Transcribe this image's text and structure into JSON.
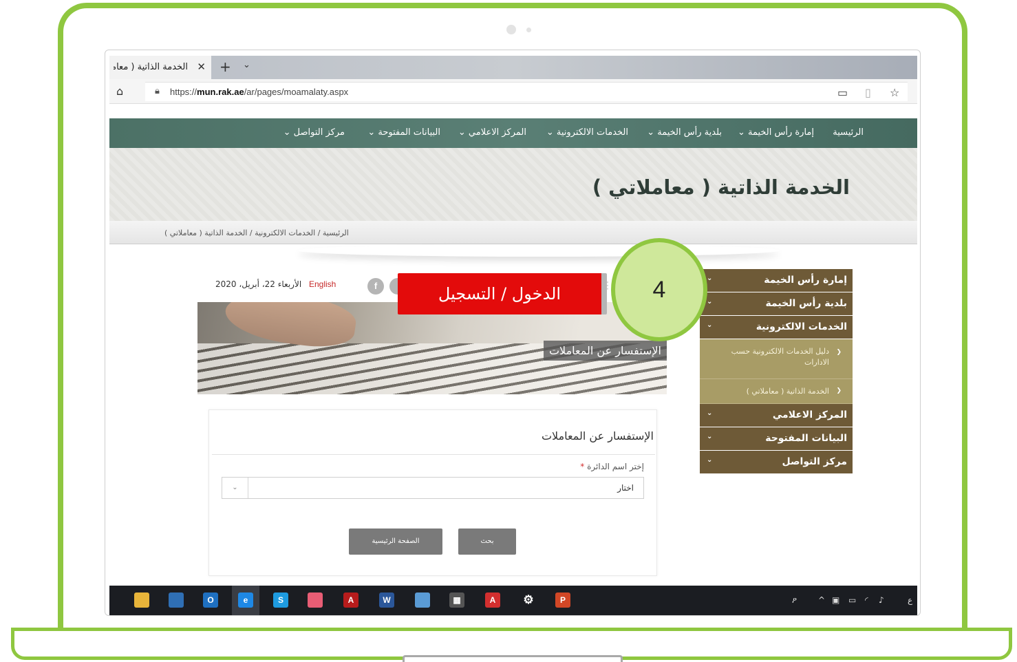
{
  "browser": {
    "tab_title": "الخدمة الذاتية ( معاملاتي )",
    "url_prefix": "https://",
    "url_domain": "mun.rak.ae",
    "url_path": "/ar/pages/moamalaty.aspx"
  },
  "nav": {
    "items": [
      {
        "label": "الرئيسية"
      },
      {
        "label": "إمارة رأس الخيمة ⌄"
      },
      {
        "label": "بلدية رأس الخيمة ⌄"
      },
      {
        "label": "الخدمات الالكترونية ⌄"
      },
      {
        "label": "المركز الاعلامي ⌄"
      },
      {
        "label": "البيانات المفتوحة ⌄"
      },
      {
        "label": "مركز التواصل ⌄"
      }
    ]
  },
  "page": {
    "title": "الخدمة الذاتية ( معاملاتي )",
    "breadcrumb": "الرئيسية / الخدمات الالكترونية / الخدمة الذاتية ( معاملاتي )",
    "date": "الأربعاء 22، أبريل، 2020",
    "english_link": "English",
    "banner_label": "الإستفسار عن المعاملات"
  },
  "sidebar": {
    "items": [
      {
        "label": "إمارة رأس الخيمة"
      },
      {
        "label": "بلدية رأس الخيمة"
      },
      {
        "label": "الخدمات الالكترونية"
      },
      {
        "label": "المركز الاعلامي"
      },
      {
        "label": "البيانات المفتوحة"
      },
      {
        "label": "مركز التواصل"
      }
    ],
    "sub_items": [
      {
        "label": "دليل الخدمات الالكترونية حسب الادارات"
      },
      {
        "label": "الخدمة الذاتية ( معاملاتي )"
      }
    ]
  },
  "form": {
    "title": "الإستفسار عن المعاملات",
    "field_label": "إختر اسم الدائرة",
    "required_mark": "*",
    "select_value": "اختار",
    "search_button": "بحث",
    "home_button": "الصفحة الرئيسية"
  },
  "overlay": {
    "callout_text": "الدخول / التسجيل",
    "step_number": "4"
  },
  "taskbar": {
    "tray_lang": "ع"
  },
  "colors": {
    "laptop_frame": "#8fc740",
    "nav_bg": "#4c7166",
    "sidebar_bg": "#6e5a37",
    "sidebar_sub_bg": "#a89c66",
    "callout_bg": "#e30b0b",
    "button_bg": "#7a7a7a"
  }
}
